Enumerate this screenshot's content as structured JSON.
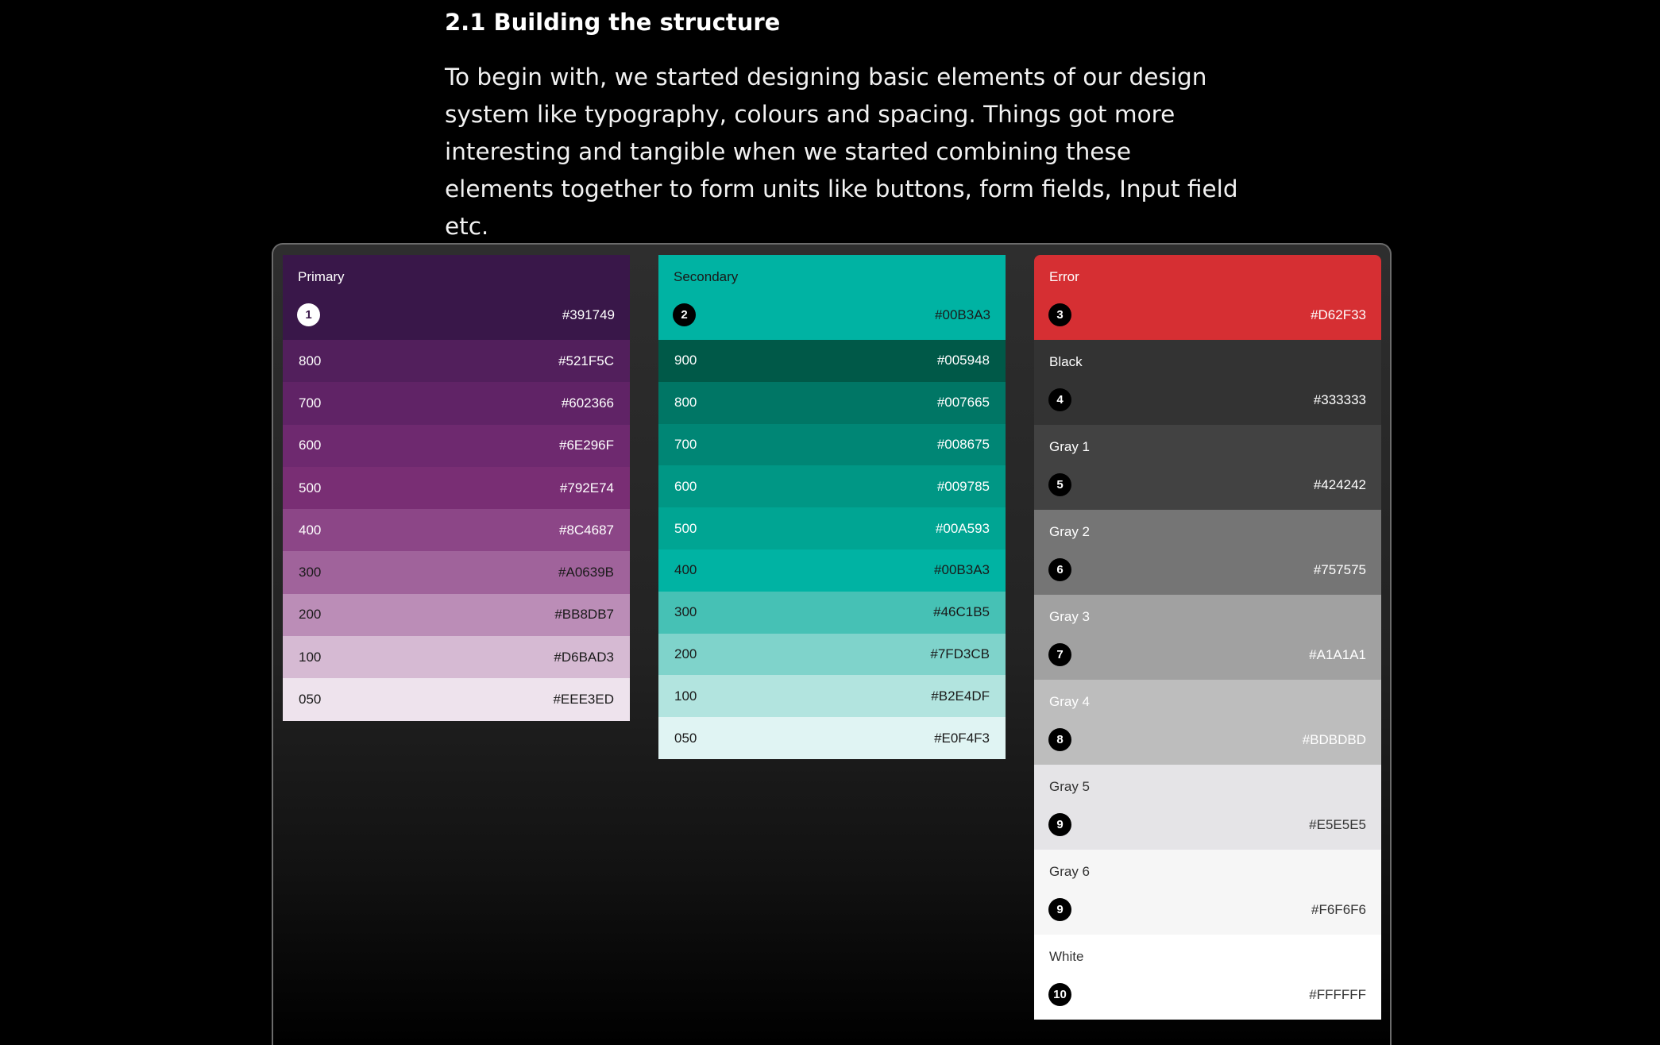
{
  "section": {
    "heading": "2.1 Building the structure",
    "paragraph": "To begin with, we started designing basic elements of our design system like typography, colours and spacing. Things got more interesting and tangible when we started combining these elements together to form units like buttons, form fields, Input field etc."
  },
  "primary": {
    "name": "Primary",
    "number": "1",
    "hex": "#391749",
    "color": "#391749",
    "shades": [
      {
        "label": "800",
        "hex": "#521F5C",
        "color": "#521F5C",
        "text": "#ffffff"
      },
      {
        "label": "700",
        "hex": "#602366",
        "color": "#602366",
        "text": "#ffffff"
      },
      {
        "label": "600",
        "hex": "#6E296F",
        "color": "#6E296F",
        "text": "#ffffff"
      },
      {
        "label": "500",
        "hex": "#792E74",
        "color": "#792E74",
        "text": "#ffffff"
      },
      {
        "label": "400",
        "hex": "#8C4687",
        "color": "#8C4687",
        "text": "#ffffff"
      },
      {
        "label": "300",
        "hex": "#A0639B",
        "color": "#A0639B",
        "text": "#1a1a1a"
      },
      {
        "label": "200",
        "hex": "#BB8DB7",
        "color": "#BB8DB7",
        "text": "#1a1a1a"
      },
      {
        "label": "100",
        "hex": "#D6BAD3",
        "color": "#D6BAD3",
        "text": "#1a1a1a"
      },
      {
        "label": "050",
        "hex": "#EEE3ED",
        "color": "#EEE3ED",
        "text": "#1a1a1a"
      }
    ]
  },
  "secondary": {
    "name": "Secondary",
    "number": "2",
    "hex": "#00B3A3",
    "color": "#00B3A3",
    "shades": [
      {
        "label": "900",
        "hex": "#005948",
        "color": "#005948",
        "text": "#ffffff"
      },
      {
        "label": "800",
        "hex": "#007665",
        "color": "#007665",
        "text": "#ffffff"
      },
      {
        "label": "700",
        "hex": "#008675",
        "color": "#008675",
        "text": "#ffffff"
      },
      {
        "label": "600",
        "hex": "#009785",
        "color": "#009785",
        "text": "#ffffff"
      },
      {
        "label": "500",
        "hex": "#00A593",
        "color": "#00A593",
        "text": "#ffffff"
      },
      {
        "label": "400",
        "hex": "#00B3A3",
        "color": "#00B3A3",
        "text": "#1a1a1a"
      },
      {
        "label": "300",
        "hex": "#46C1B5",
        "color": "#46C1B5",
        "text": "#1a1a1a"
      },
      {
        "label": "200",
        "hex": "#7FD3CB",
        "color": "#7FD3CB",
        "text": "#1a1a1a"
      },
      {
        "label": "100",
        "hex": "#B2E4DF",
        "color": "#B2E4DF",
        "text": "#1a1a1a"
      },
      {
        "label": "050",
        "hex": "#E0F4F3",
        "color": "#E0F4F3",
        "text": "#1a1a1a"
      }
    ]
  },
  "neutrals": [
    {
      "name": "Error",
      "number": "3",
      "hex": "#D62F33",
      "color": "#D62F33",
      "text": "#ffffff"
    },
    {
      "name": "Black",
      "number": "4",
      "hex": "#333333",
      "color": "#333333",
      "text": "#ffffff"
    },
    {
      "name": "Gray 1",
      "number": "5",
      "hex": "#424242",
      "color": "#424242",
      "text": "#ffffff"
    },
    {
      "name": "Gray 2",
      "number": "6",
      "hex": "#757575",
      "color": "#757575",
      "text": "#ffffff"
    },
    {
      "name": "Gray 3",
      "number": "7",
      "hex": "#A1A1A1",
      "color": "#A1A1A1",
      "text": "#ffffff"
    },
    {
      "name": "Gray 4",
      "number": "8",
      "hex": "#BDBDBD",
      "color": "#BDBDBD",
      "text": "#ffffff"
    },
    {
      "name": "Gray 5",
      "number": "9",
      "hex": "#E5E5E5",
      "color": "#E5E4E7",
      "text": "#333333"
    },
    {
      "name": "Gray 6",
      "number": "9",
      "hex": "#F6F6F6",
      "color": "#F6F6F6",
      "text": "#333333"
    },
    {
      "name": "White",
      "number": "10",
      "hex": "#FFFFFF",
      "color": "#FFFFFF",
      "text": "#333333"
    }
  ]
}
